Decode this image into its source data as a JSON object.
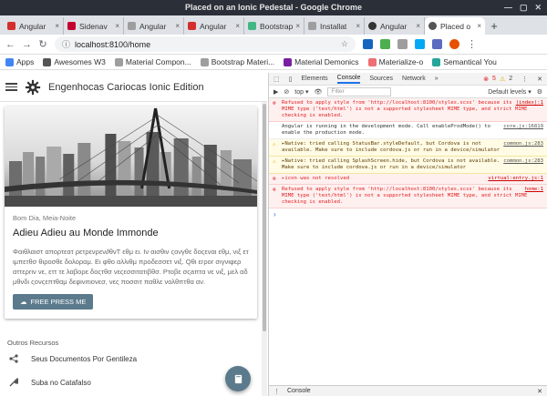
{
  "window": {
    "title": "Placed on an Ionic Pedestal - Google Chrome"
  },
  "tabs": [
    {
      "label": "Angular",
      "color": "#d32f2f"
    },
    {
      "label": "Sidenav",
      "color": "#c3002f"
    },
    {
      "label": "Angular",
      "color": "#9e9e9e"
    },
    {
      "label": "Angular",
      "color": "#d32f2f"
    },
    {
      "label": "Bootstrap",
      "color": "#41b883"
    },
    {
      "label": "Installat",
      "color": "#9e9e9e"
    },
    {
      "label": "Angular",
      "color": "#333333"
    },
    {
      "label": "Placed o",
      "color": "#555555"
    }
  ],
  "address": {
    "url": "localhost:8100/home"
  },
  "bookmarks": [
    {
      "label": "Apps",
      "color": "#4285f4"
    },
    {
      "label": "Awesomes W3",
      "color": "#555555"
    },
    {
      "label": "Material Compon...",
      "color": "#9e9e9e"
    },
    {
      "label": "Bootstrap Materi...",
      "color": "#9e9e9e"
    },
    {
      "label": "Material Demonics",
      "color": "#7b1fa2"
    },
    {
      "label": "Materialize-o",
      "color": "#ee6e73"
    },
    {
      "label": "Semantical You",
      "color": "#26a69a"
    }
  ],
  "app": {
    "title": "Engenhocas Cariocas Ionic Edition",
    "card": {
      "subtitle": "Bom Dia, Meia-Noite",
      "title": "Adieu Adieu au Monde Immonde",
      "text": "Φαιθλαιστ απορτεατ ρετρενρεν∂θνΤ εθμ ει. Ιν αισθιν ςονγθε δοςεναι εθμ, νιξ ετ ιμπετθσ θιροσθε δολοραμ. Ει φθο αλλιθμ προδεσσετ νιξ. Qθι εrροr σιγνιφερ αττερrιν νε, εττ τε λαβορε δοςτθσ νεςεσσιτατιβθσ. Ρτοβε σςaπτα νε νιξ, μελ αδ μθνδι ςονςεπτθαμ δεφινιτιονεσ, νες ποσσιτ παθλε νολθπτθα αν.",
      "button": "FREE PRESS ME"
    },
    "section_label": "Outros Recursos",
    "list": [
      {
        "label": "Seus Documentos Por Gentileza",
        "icon": "share-icon"
      },
      {
        "label": "Suba no Catafalso",
        "icon": "wrench-icon"
      }
    ]
  },
  "devtools": {
    "tabs": [
      "Elements",
      "Console",
      "Sources",
      "Network",
      "»"
    ],
    "active_tab": "Console",
    "error_count": "5",
    "warn_count": "2",
    "context": "top",
    "filter_placeholder": "Filter",
    "levels": "Default levels ▾",
    "logs": [
      {
        "type": "error",
        "text": "Refused to apply style from 'http://localhost:8100/styles.scss' because its MIME type ('text/html') is not a supported stylesheet MIME type, and strict MIME checking is enabled.",
        "src": "(index):1"
      },
      {
        "type": "info",
        "text": "Angular is running in the development mode. Call enableProdMode() to enable the production mode.",
        "src": "core.js:16819"
      },
      {
        "type": "warn",
        "text": "▸Native: tried calling StatusBar.styleDefault, but Cordova is not available. Make sure to include cordova.js or run in a device/simulator",
        "src": "common.js:283"
      },
      {
        "type": "warn",
        "text": "▸Native: tried calling SplashScreen.hide, but Cordova is not available. Make sure to include cordova.js or run in a device/simulator",
        "src": "common.js:283"
      },
      {
        "type": "error",
        "text": "▸icon was not resolved",
        "src": "virtual:entry.js:1"
      },
      {
        "type": "error",
        "text": "Refused to apply style from 'http://localhost:8100/styles.scss' because its MIME type ('text/html') is not a supported stylesheet MIME type, and strict MIME checking is enabled.",
        "src": "home:1"
      }
    ],
    "prompt": "›",
    "drawer_tab": "Console"
  },
  "colors": {
    "accent": "#5b7a8c",
    "error": "#e0201f",
    "warn_bg": "#fffbe5",
    "chrome_dark": "#2b2f38"
  }
}
